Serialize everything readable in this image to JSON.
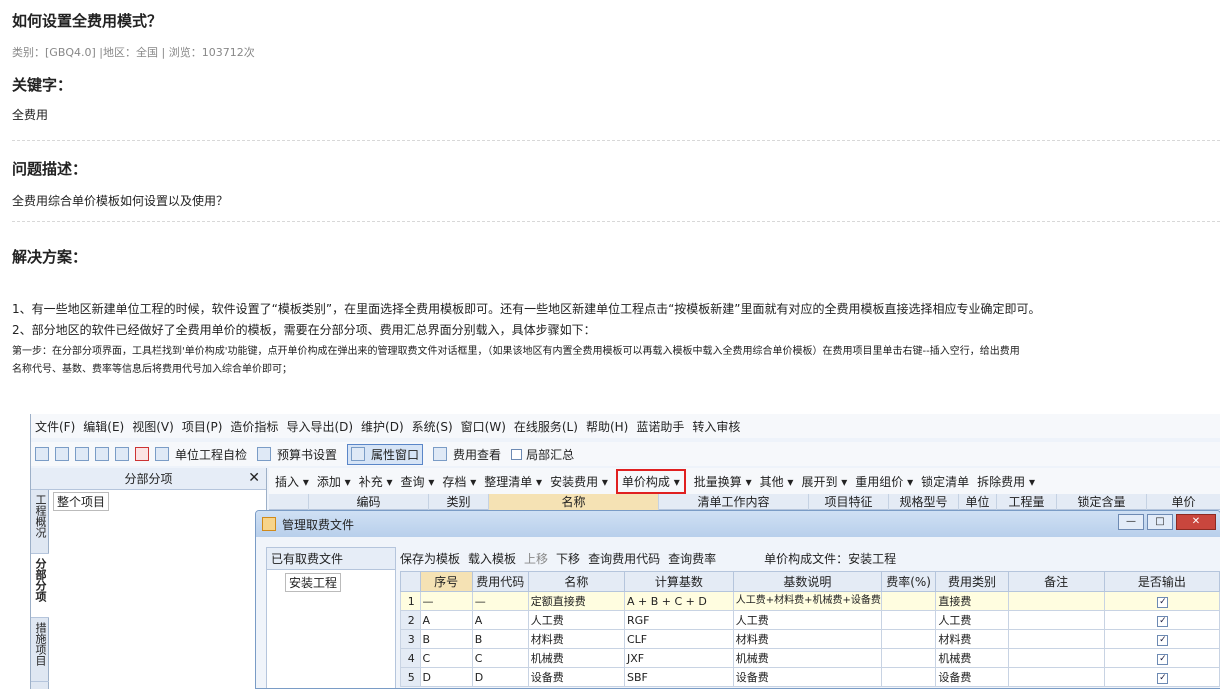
{
  "article": {
    "title": "如何设置全费用模式？",
    "meta": "类别：[GBQ4.0]  |地区：全国 |  浏览：103712次",
    "keywords_heading": "关键字：",
    "keywords": "全费用",
    "problem_heading": "问题描述：",
    "problem": "全费用综合单价模板如何设置以及使用？",
    "solution_heading": "解决方案：",
    "line1": "1、有一些地区新建单位工程的时候，软件设置了“模板类别”，在里面选择全费用模板即可。还有一些地区新建单位工程点击“按模板新建”里面就有对应的全费用模板直接选择相应专业确定即可。",
    "line2": "2、部分地区的软件已经做好了全费用单价的模板，需要在分部分项、费用汇总界面分别载入，具体步骤如下：",
    "step1a": "第一步：在分部分项界面，工具栏找到'单价构成'功能键，点开单价构成在弹出来的管理取费文件对话框里，（如果该地区有内置全费用模板可以再载入模板中载入全费用综合单价模板）在费用项目里单击右键--插入空行，给出费用",
    "step1b": "名称代号、基数、费率等信息后将费用代号加入综合单价即可；"
  },
  "app": {
    "menu": [
      "文件(F)",
      "编辑(E)",
      "视图(V)",
      "项目(P)",
      "造价指标",
      "导入导出(D)",
      "维护(D)",
      "系统(S)",
      "窗口(W)",
      "在线服务(L)",
      "帮助(H)",
      "蓝诺助手",
      "转入审核"
    ],
    "toolbar1": [
      "单位工程自检",
      "预算书设置",
      "属性窗口",
      "费用查看",
      "局部汇总"
    ],
    "left_panel_title": "分部分项",
    "vtabs": [
      "工程概况",
      "分部分项",
      "措施项目"
    ],
    "tree_root": "整个项目",
    "toolbar2": [
      "插入 ▾",
      "添加 ▾",
      "补充 ▾",
      "查询 ▾",
      "存档 ▾",
      "整理清单 ▾",
      "安装费用 ▾",
      "单价构成 ▾",
      "批量换算 ▾",
      "其他 ▾",
      "展开到 ▾",
      "重用组价 ▾",
      "锁定清单",
      "拆除费用 ▾"
    ],
    "grid_columns": [
      "编码",
      "类别",
      "名称",
      "清单工作内容",
      "项目特征",
      "规格型号",
      "单位",
      "工程量",
      "锁定含量",
      "单价"
    ]
  },
  "dialog": {
    "title": "管理取费文件",
    "left_header": "已有取费文件",
    "left_item": "安装工程",
    "tools": [
      "保存为模板",
      "载入模板",
      "上移",
      "下移",
      "查询费用代码",
      "查询费率"
    ],
    "file_label": "单价构成文件：安装工程",
    "columns": [
      "序号",
      "费用代码",
      "名称",
      "计算基数",
      "基数说明",
      "费率(%)",
      "费用类别",
      "备注",
      "是否输出"
    ],
    "rows": [
      {
        "rn": "1",
        "seq": "—",
        "code": "—",
        "name": "定额直接费",
        "base": "A + B + C + D",
        "desc": "人工费+材料费+机械费+设备费",
        "rate": "",
        "type": "直接费",
        "note": "",
        "out": "✓"
      },
      {
        "rn": "2",
        "seq": "A",
        "code": "A",
        "name": "人工费",
        "base": "RGF",
        "desc": "人工费",
        "rate": "",
        "type": "人工费",
        "note": "",
        "out": "✓"
      },
      {
        "rn": "3",
        "seq": "B",
        "code": "B",
        "name": "材料费",
        "base": "CLF",
        "desc": "材料费",
        "rate": "",
        "type": "材料费",
        "note": "",
        "out": "✓"
      },
      {
        "rn": "4",
        "seq": "C",
        "code": "C",
        "name": "机械费",
        "base": "JXF",
        "desc": "机械费",
        "rate": "",
        "type": "机械费",
        "note": "",
        "out": "✓"
      },
      {
        "rn": "5",
        "seq": "D",
        "code": "D",
        "name": "设备费",
        "base": "SBF",
        "desc": "设备费",
        "rate": "",
        "type": "设备费",
        "note": "",
        "out": "✓"
      }
    ]
  }
}
